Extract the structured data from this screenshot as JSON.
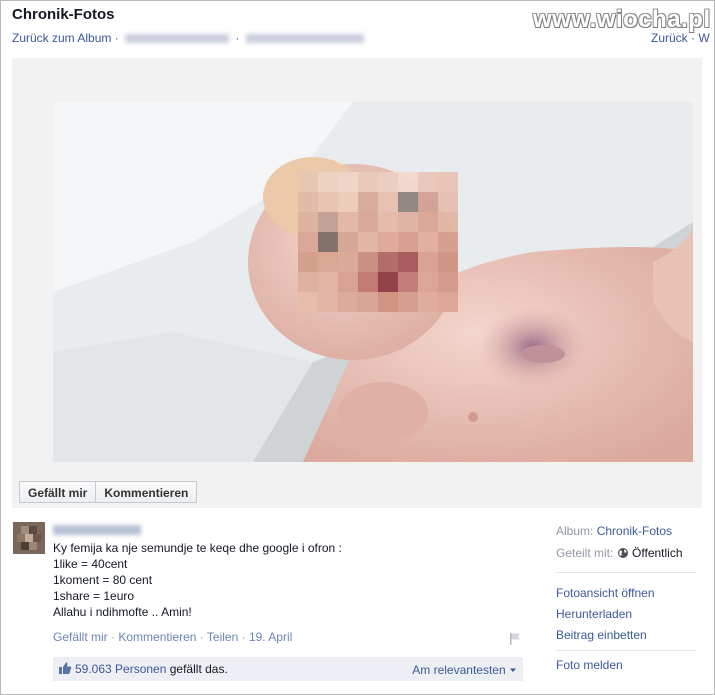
{
  "header": {
    "title": "Chronik-Fotos",
    "back_link": "Zurück zum Album",
    "separator": "·",
    "right_link": "Zurück · W"
  },
  "watermark": "www.wiocha.pl",
  "photo_actions": {
    "like": "Gefällt mir",
    "comment": "Kommentieren"
  },
  "post": {
    "lines": [
      "Ky femija ka nje semundje te keqe dhe google i ofron :",
      "1like = 40cent",
      "1koment = 80 cent",
      "1share = 1euro",
      "Allahu i ndihmofte .. Amin!"
    ],
    "actions": {
      "like": "Gefällt mir",
      "comment": "Kommentieren",
      "share": "Teilen",
      "date": "19. April",
      "dot": "·"
    }
  },
  "likes": {
    "count": "59.063 Personen",
    "suffix": "gefällt das.",
    "sort": "Am relevantesten"
  },
  "sidebar": {
    "album_label": "Album:",
    "album_value": "Chronik-Fotos",
    "shared_label": "Geteilt mit:",
    "shared_value": "Öffentlich",
    "links": [
      "Fotoansicht öffnen",
      "Herunterladen",
      "Beitrag einbetten"
    ],
    "report": "Foto melden"
  },
  "colors": {
    "link": "#3b5998",
    "muted": "#9197a3",
    "panel": "#edeff4"
  },
  "icons": [
    "thumbs-up-icon",
    "globe-icon",
    "flag-icon",
    "caret-down-icon"
  ]
}
